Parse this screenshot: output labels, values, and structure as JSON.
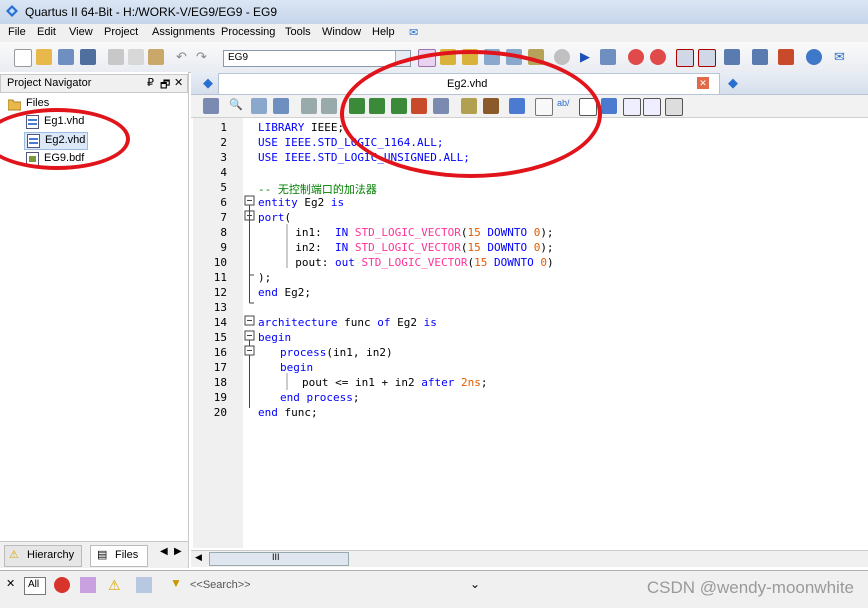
{
  "window": {
    "title": "Quartus II 64-Bit - H:/WORK-V/EG9/EG9 - EG9"
  },
  "menu": {
    "items": [
      "File",
      "Edit",
      "View",
      "Project",
      "Assignments",
      "Processing",
      "Tools",
      "Window",
      "Help"
    ]
  },
  "toolbar": {
    "project_combo": "EG9"
  },
  "navigator": {
    "title": "Project Navigator",
    "pin": "₽",
    "float": "🗗",
    "close": "✕",
    "files_folder": "Files",
    "files": [
      "Eg1.vhd",
      "Eg2.vhd",
      "EG9.bdf"
    ],
    "selected_file": "Eg2.vhd",
    "tabs": [
      "Hierarchy",
      "Files"
    ]
  },
  "editor": {
    "tab_name": "Eg2.vhd",
    "line_numbers": [
      "1",
      "2",
      "3",
      "4",
      "5",
      "6",
      "7",
      "8",
      "9",
      "10",
      "11",
      "12",
      "13",
      "14",
      "15",
      "16",
      "17",
      "18",
      "19",
      "20"
    ],
    "code": {
      "l1_kw": "LIBRARY",
      "l1_rest": " IEEE;",
      "l2_kw": "USE",
      "l2_rest": " IEEE.STD_LOGIC_1164.ALL;",
      "l3_kw": "USE",
      "l3_rest": " IEEE.STD_LOGIC_UNSIGNED.ALL;",
      "l5": "-- 无控制端口的加法器",
      "l6_kw1": "entity",
      "l6_mid": " Eg2 ",
      "l6_kw2": "is",
      "l7_kw": "port",
      "l7_rest": "(",
      "l8_a": "  in1:  ",
      "l8_kw": "IN",
      "l8_ty": " STD_LOGIC_VECTOR",
      "l8_b": "(",
      "l8_n1": "15",
      "l8_dt": " DOWNTO ",
      "l8_n2": "0",
      "l8_c": ");",
      "l9_a": "  in2:  ",
      "l9_kw": "IN",
      "l9_ty": " STD_LOGIC_VECTOR",
      "l9_b": "(",
      "l9_n1": "15",
      "l9_dt": " DOWNTO ",
      "l9_n2": "0",
      "l9_c": ");",
      "l10_a": "  pout: ",
      "l10_kw": "out",
      "l10_ty": " STD_LOGIC_VECTOR",
      "l10_b": "(",
      "l10_n1": "15",
      "l10_dt": " DOWNTO ",
      "l10_n2": "0",
      "l10_c": ")",
      "l11": ");",
      "l12_kw": "end",
      "l12_rest": " Eg2;",
      "l14_kw1": "architecture",
      "l14_m1": " func ",
      "l14_kw2": "of",
      "l14_m2": " Eg2 ",
      "l14_kw3": "is",
      "l15_kw": "begin",
      "l16_kw": "process",
      "l16_rest": "(in1, in2)",
      "l17_kw": "begin",
      "l18_a": "pout <= in1 + in2 ",
      "l18_kw": "after",
      "l18_sp": " ",
      "l18_n": "2ns",
      "l18_c": ";",
      "l19_kw": "end process",
      "l19_c": ";",
      "l20_kw": "end",
      "l20_rest": " func;"
    }
  },
  "hscroll": {
    "grip": "III"
  },
  "messages": {
    "filter_all": "All",
    "search_placeholder": "<<Search>>"
  },
  "watermark": "CSDN @wendy-moonwhite",
  "colors": {
    "keyword": "#0000ff",
    "type": "#ff3399",
    "number": "#e05c00",
    "comment": "#008000",
    "annotation": "#e0141a"
  }
}
